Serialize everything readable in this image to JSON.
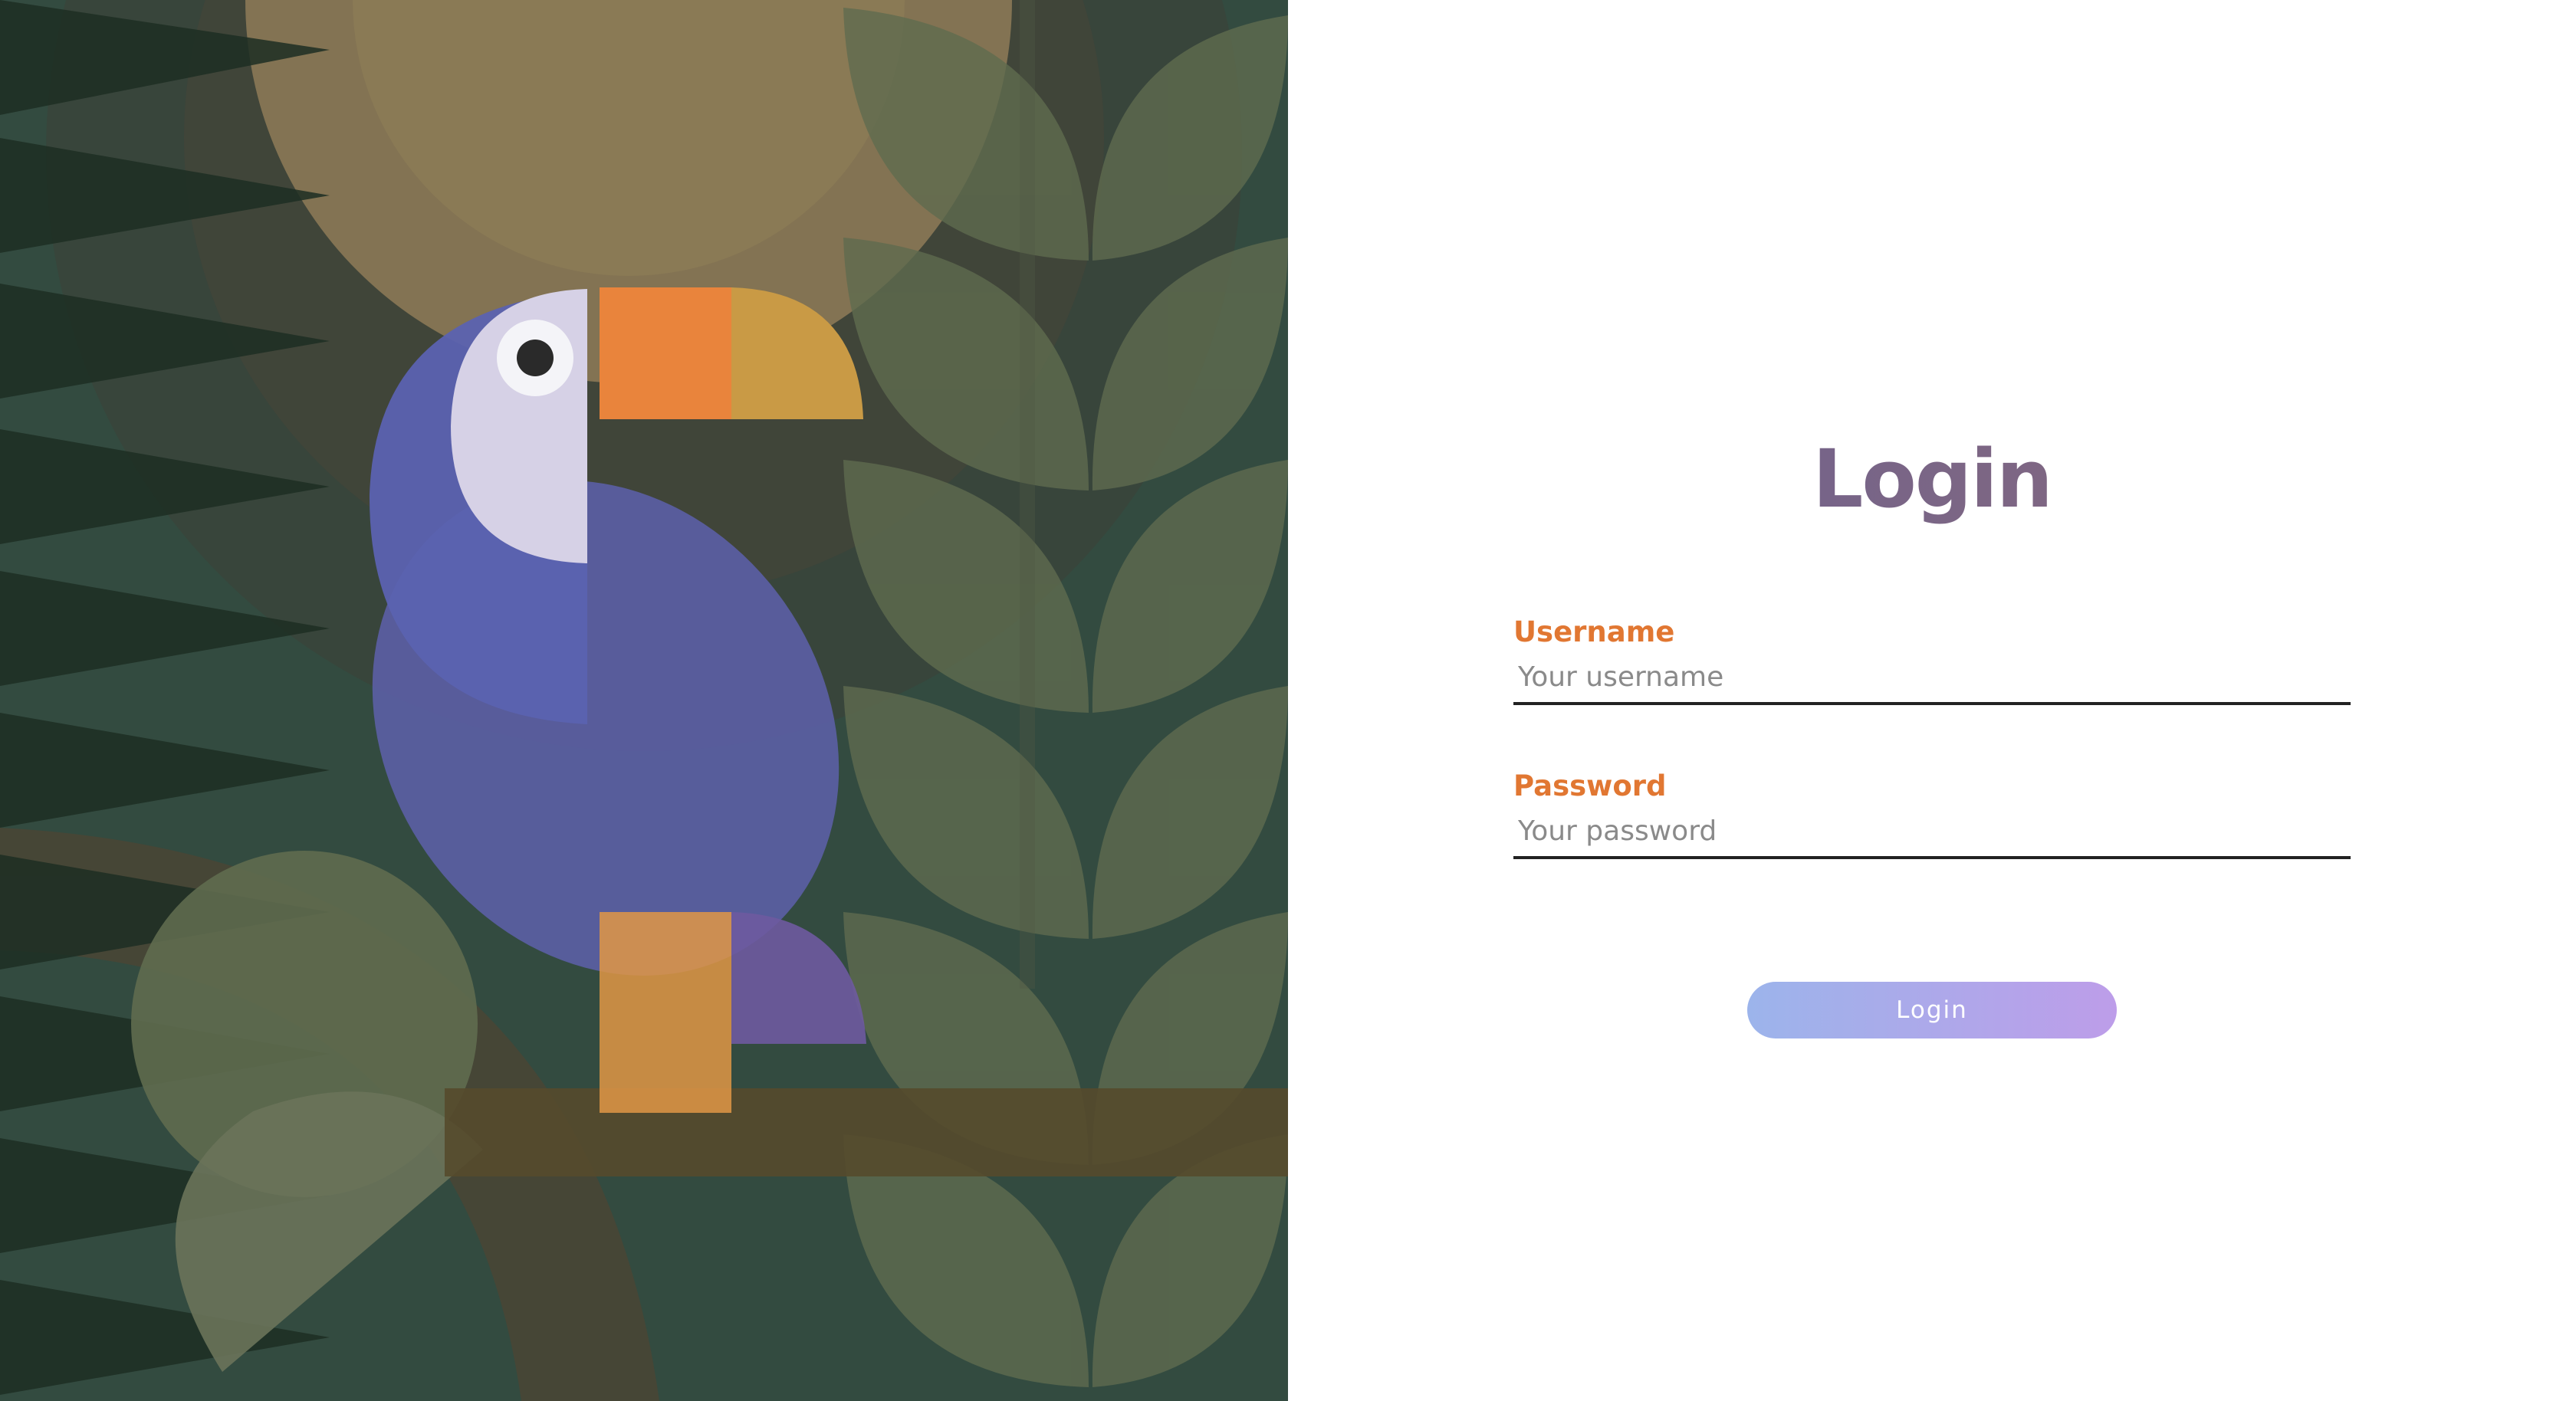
{
  "login": {
    "title": "Login",
    "username": {
      "label": "Username",
      "placeholder": "Your username",
      "value": ""
    },
    "password": {
      "label": "Password",
      "placeholder": "Your password",
      "value": ""
    },
    "submit_label": "Login"
  },
  "illustration": {
    "subject": "toucan-on-branch",
    "colors": {
      "jungle_dark": "#334b40",
      "moon": "#837353",
      "leaf": "#5f6b4f",
      "toucan_body": "#5a5ea0",
      "toucan_face": "#d6d1e6",
      "beak_orange": "#e9843c",
      "beak_yellow": "#c99a45",
      "branch": "#554a2c"
    }
  },
  "theme": {
    "accent_label": "#e17732",
    "title_gradient": [
      "#665f93",
      "#8f6c78"
    ],
    "button_gradient": [
      "#9cb4eb",
      "#bd9de9"
    ]
  }
}
